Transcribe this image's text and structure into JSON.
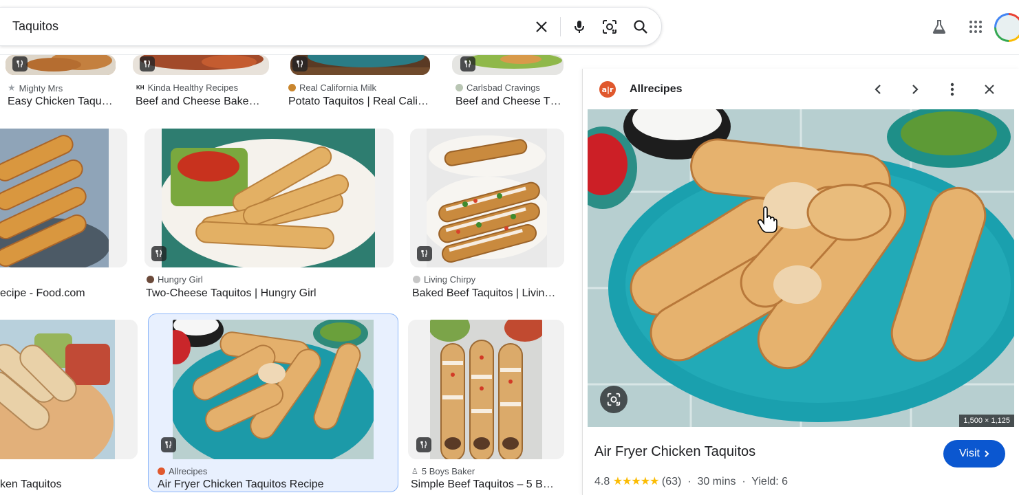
{
  "search": {
    "query": "Taquitos"
  },
  "header": {
    "icons": [
      "clear-icon",
      "microphone-icon",
      "lens-icon",
      "search-icon",
      "labs-flask-icon",
      "apps-grid-icon"
    ]
  },
  "grid": {
    "row1": [
      {
        "source": "Mighty Mrs",
        "title": "Easy Chicken Taqu…"
      },
      {
        "source": "Kinda Healthy Recipes",
        "title": "Beef and Cheese Bake…"
      },
      {
        "source": "Real California Milk",
        "title": "Potato Taquitos | Real Cali…"
      },
      {
        "source": "Carlsbad Cravings",
        "title": "Beef and Cheese T…"
      }
    ],
    "row2": [
      {
        "source": "",
        "title": "ecipe - Food.com"
      },
      {
        "source": "Hungry Girl",
        "title": "Two-Cheese Taquitos | Hungry Girl"
      },
      {
        "source": "Living Chirpy",
        "title": "Baked Beef Taquitos | Livin…"
      }
    ],
    "row3": [
      {
        "source": "",
        "title": "ken Taquitos"
      },
      {
        "source": "Allrecipes",
        "title": "Air Fryer Chicken Taquitos Recipe"
      },
      {
        "source": "5 Boys Baker",
        "title": "Simple Beef Taquitos – 5 B…"
      }
    ]
  },
  "panel": {
    "logo_text": "a|r",
    "source": "Allrecipes",
    "image_dims": "1,500 × 1,125",
    "title": "Air Fryer Chicken Taquitos",
    "visit_label": "Visit",
    "rating": "4.8",
    "stars": "★★★★★",
    "reviews": "(63)",
    "time": "30 mins",
    "yield": "Yield: 6",
    "separator": "·"
  },
  "colors": {
    "accent": "#0b57d0",
    "star": "#fbbc04",
    "selected_bg": "#e8f0fe"
  }
}
